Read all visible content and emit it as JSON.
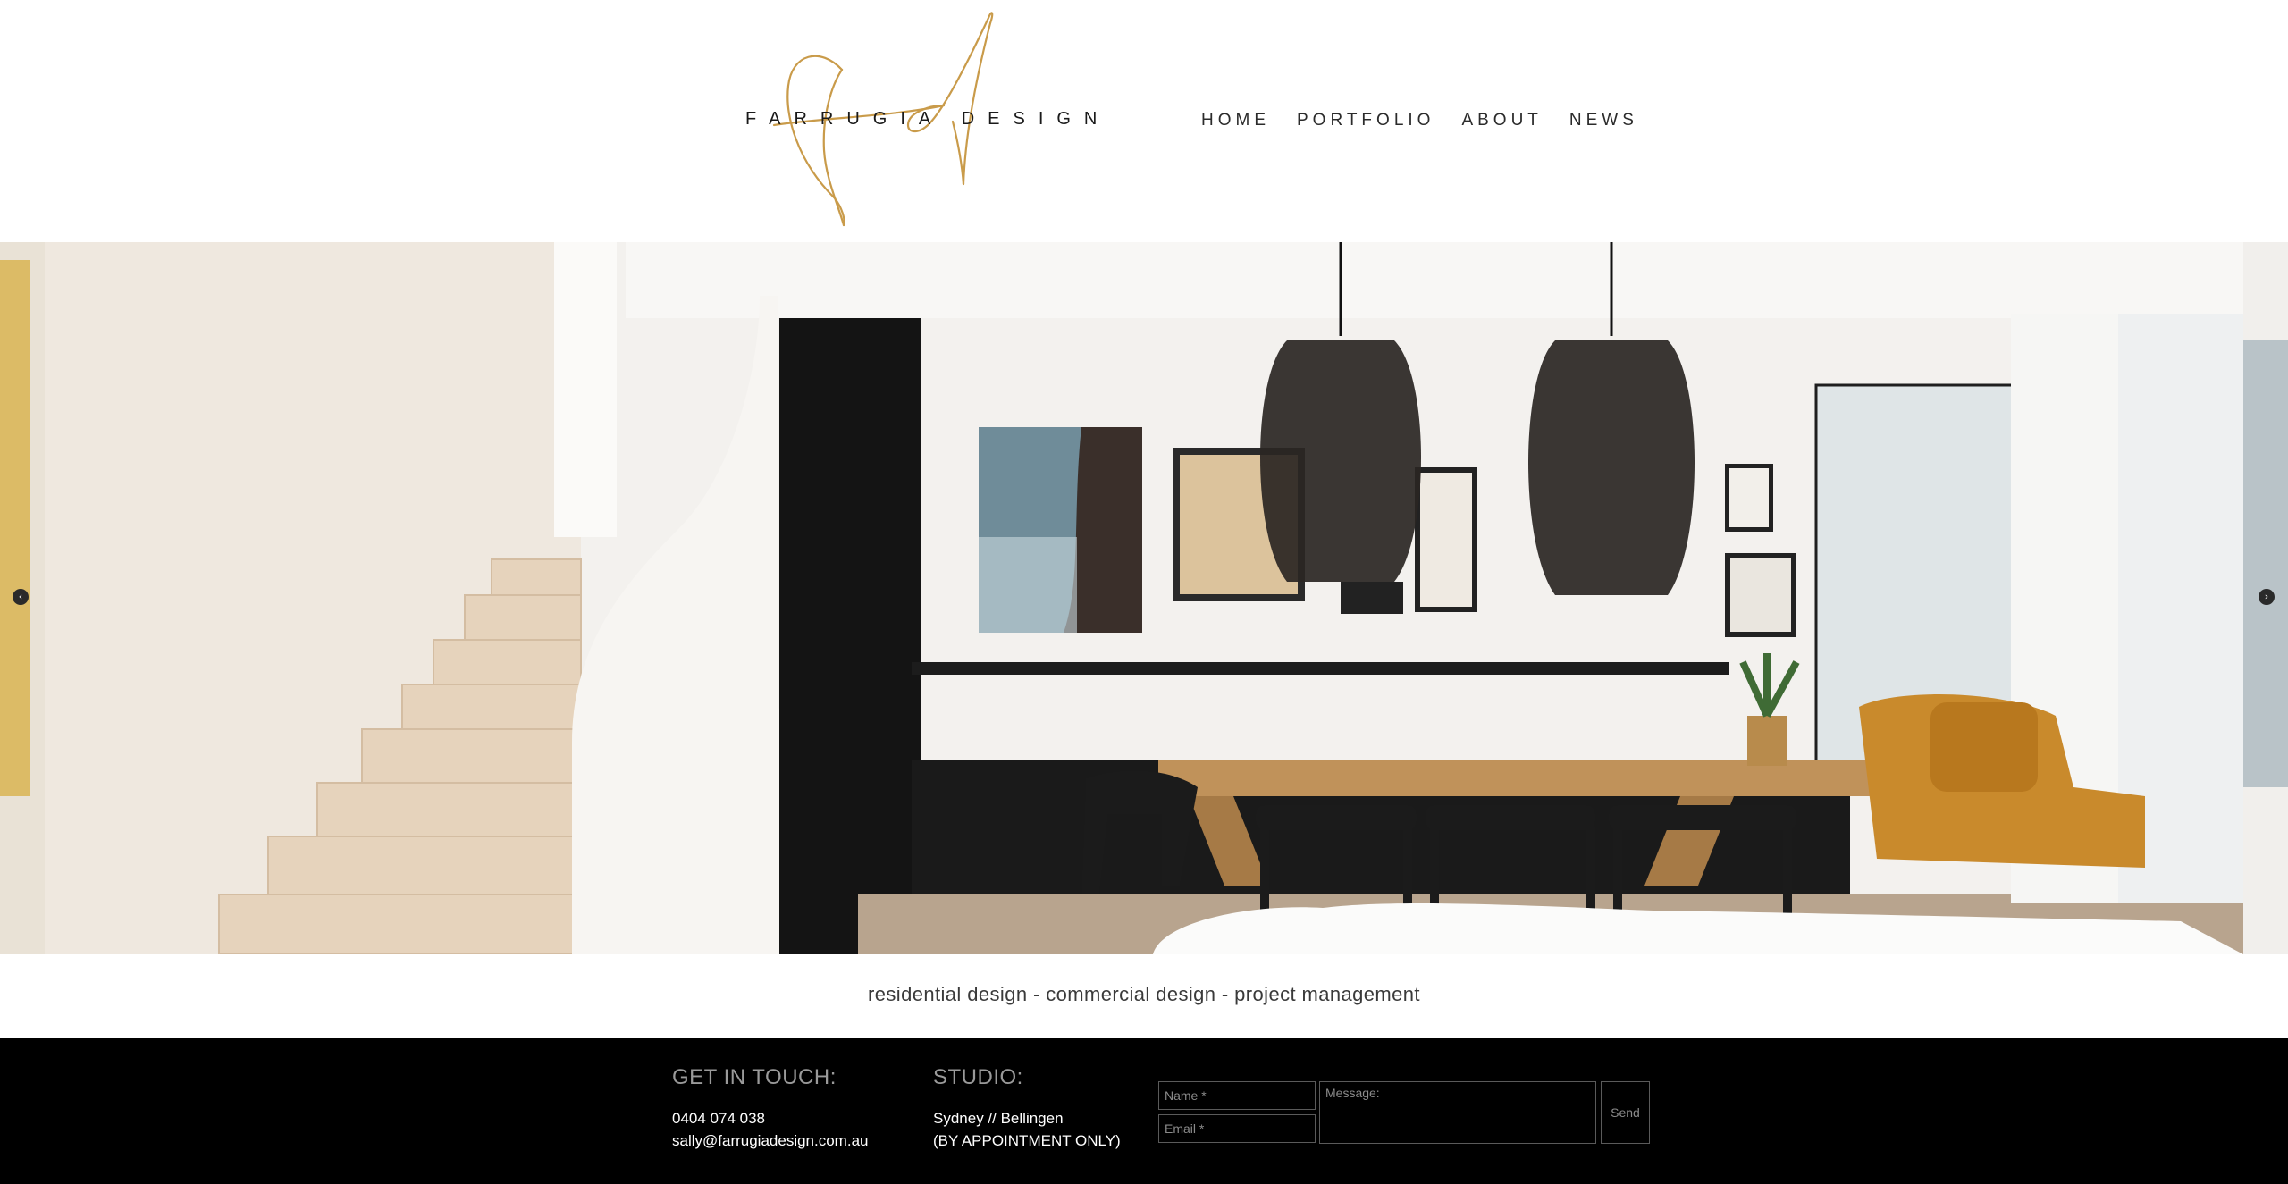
{
  "brand": {
    "logo_text": "FARRUGIA DESIGN",
    "logo_monogram": "fd",
    "gold": "#c99b4a"
  },
  "nav": {
    "items": [
      {
        "label": "HOME"
      },
      {
        "label": "PORTFOLIO"
      },
      {
        "label": "ABOUT"
      },
      {
        "label": "NEWS"
      }
    ]
  },
  "slider": {
    "prev_icon": "chevron-left-icon",
    "next_icon": "chevron-right-icon",
    "prev_glyph": "‹",
    "next_glyph": "›"
  },
  "tagline": "residential design - commercial design - project management",
  "footer": {
    "contact": {
      "heading": "GET IN TOUCH:",
      "phone": "0404 074 038",
      "email": "sally@farrugiadesign.com.au"
    },
    "studio": {
      "heading": "STUDIO:",
      "location": "Sydney // Bellingen",
      "note": "(BY APPOINTMENT ONLY)"
    },
    "form": {
      "name_placeholder": "Name *",
      "email_placeholder": "Email *",
      "message_placeholder": "Message:",
      "send_label": "Send"
    }
  },
  "colors": {
    "footer_bg": "#000000",
    "header_bg": "#ffffff"
  }
}
